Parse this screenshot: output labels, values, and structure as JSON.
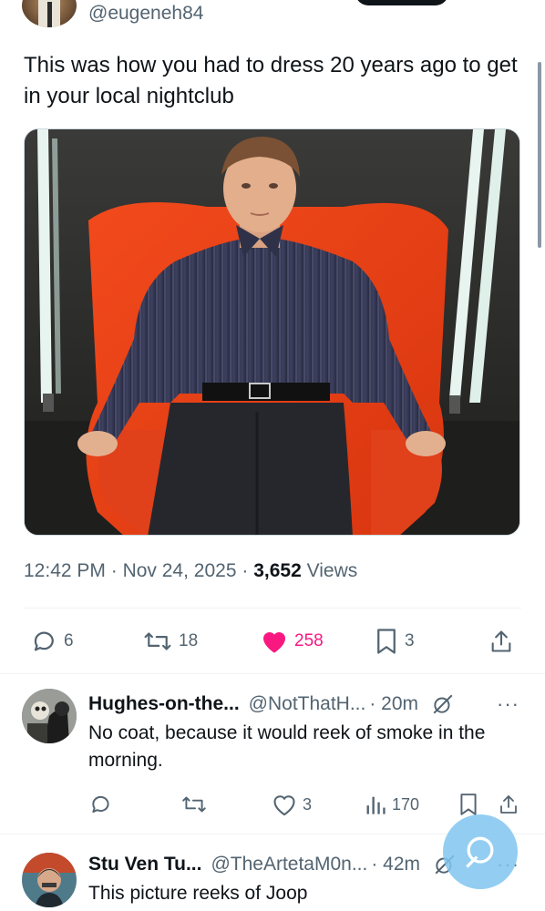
{
  "tweet": {
    "handle": "@eugeneh84",
    "text": "This was how you had to dress 20 years ago to get in your local nightclub",
    "time": "12:42 PM",
    "date": "Nov 24, 2025",
    "views_count": "3,652",
    "views_label": "Views",
    "sep": "·",
    "actions": {
      "replies": "6",
      "reposts": "18",
      "likes": "258",
      "bookmarks": "3"
    },
    "like_color": "#f91880"
  },
  "replies": [
    {
      "name": "Hughes-on-the...",
      "handle": "@NotThatH...",
      "time": "· 20m",
      "text": "No coat, because it would reek of smoke in the morning.",
      "likes": "3",
      "views": "170"
    },
    {
      "name": "Stu Ven Tu...",
      "handle": "@TheArtetaM0n...",
      "time": "· 42m",
      "text": "This picture reeks of Joop"
    }
  ],
  "icons": {
    "reply": "reply-icon",
    "repost": "repost-icon",
    "like": "heart-icon",
    "bookmark": "bookmark-icon",
    "share": "share-icon",
    "views": "views-icon",
    "grok": "grok-icon",
    "more": "more-icon"
  },
  "more_glyph": "···",
  "accent": "#1d9bf0",
  "muted": "#536471"
}
